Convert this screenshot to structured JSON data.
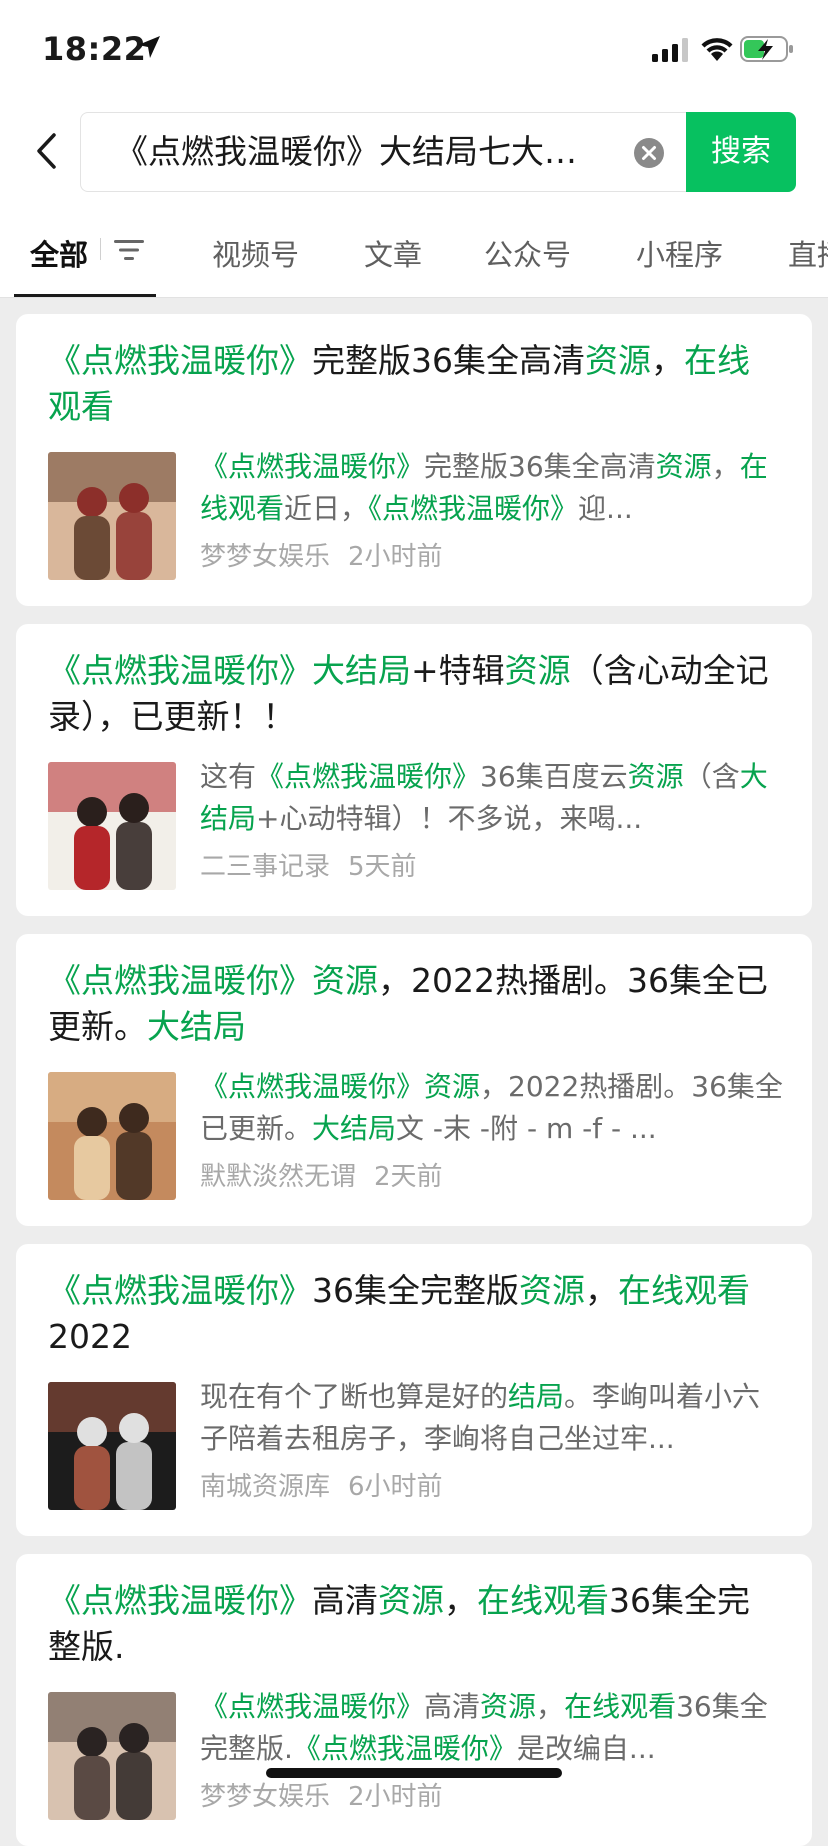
{
  "status_bar": {
    "time": "18:22",
    "icons": [
      "location-arrow-icon",
      "cellular-signal-icon",
      "wifi-icon",
      "battery-charging-icon"
    ]
  },
  "search": {
    "query": "《点燃我温暖你》大结局七大…",
    "button_label": "搜索"
  },
  "tabs": [
    {
      "label": "全部",
      "active": true
    },
    {
      "label": "视频号"
    },
    {
      "label": "文章"
    },
    {
      "label": "公众号"
    },
    {
      "label": "小程序"
    },
    {
      "label": "直播"
    }
  ],
  "colors": {
    "accent": "#07c160",
    "highlight_text": "#07a34e",
    "background": "#ededed"
  },
  "results": [
    {
      "title": [
        {
          "t": "《点燃我温暖你》",
          "hl": true
        },
        {
          "t": "完整版36集全高清"
        },
        {
          "t": "资源",
          "hl": true
        },
        {
          "t": "，"
        },
        {
          "t": "在线观看",
          "hl": true
        }
      ],
      "snippet": [
        {
          "t": "《点燃我温暖你》",
          "hl": true
        },
        {
          "t": "完整版36集全高清"
        },
        {
          "t": "资源",
          "hl": true
        },
        {
          "t": "，"
        },
        {
          "t": "在线观看",
          "hl": true
        },
        {
          "t": "近日，"
        },
        {
          "t": "《点燃我温暖你》",
          "hl": true
        },
        {
          "t": "迎..."
        }
      ],
      "source": "梦梦女娱乐",
      "time": "2小时前",
      "thumb_colors": [
        "#6b4a36",
        "#d9b79b",
        "#8c2f2a"
      ]
    },
    {
      "title": [
        {
          "t": "《点燃我温暖你》",
          "hl": true
        },
        {
          "t": "大结局",
          "hl": true
        },
        {
          "t": "+特辑"
        },
        {
          "t": "资源",
          "hl": true
        },
        {
          "t": "（含心动全记录），已更新！！"
        }
      ],
      "snippet": [
        {
          "t": "这有"
        },
        {
          "t": "《点燃我温暖你》",
          "hl": true
        },
        {
          "t": "36集百度云"
        },
        {
          "t": "资源",
          "hl": true
        },
        {
          "t": "（含"
        },
        {
          "t": "大结局",
          "hl": true
        },
        {
          "t": "+心动特辑）！不多说，来喝..."
        }
      ],
      "source": "二三事记录",
      "time": "5天前",
      "thumb_colors": [
        "#b5262a",
        "#f2efe9",
        "#2a1f1c"
      ]
    },
    {
      "title": [
        {
          "t": "《点燃我温暖你》",
          "hl": true
        },
        {
          "t": "资源",
          "hl": true
        },
        {
          "t": "，2022热播剧。36集全已更新。"
        },
        {
          "t": "大结局",
          "hl": true
        }
      ],
      "snippet": [
        {
          "t": "《点燃我温暖你》",
          "hl": true
        },
        {
          "t": "资源",
          "hl": true
        },
        {
          "t": "，2022热播剧。36集全已更新。"
        },
        {
          "t": "大结局",
          "hl": true
        },
        {
          "t": "文 -末 -附 - m -f - ..."
        }
      ],
      "source": "默默淡然无谓",
      "time": "2天前",
      "thumb_colors": [
        "#e7c9a0",
        "#c48a5e",
        "#3e2a1e"
      ]
    },
    {
      "title": [
        {
          "t": "《点燃我温暖你》",
          "hl": true
        },
        {
          "t": "36集全完整版"
        },
        {
          "t": "资源",
          "hl": true
        },
        {
          "t": "，"
        },
        {
          "t": "在线观看",
          "hl": true
        },
        {
          "t": "2022"
        }
      ],
      "snippet": [
        {
          "t": "现在有个了断也算是好的"
        },
        {
          "t": "结局",
          "hl": true
        },
        {
          "t": "。李峋叫着小六子陪着去租房子，李峋将自己坐过牢..."
        }
      ],
      "source": "南城资源库",
      "time": "6小时前",
      "thumb_colors": [
        "#a0533f",
        "#1c1c1c",
        "#e0e0e0"
      ]
    },
    {
      "title": [
        {
          "t": "《点燃我温暖你》",
          "hl": true
        },
        {
          "t": "高清"
        },
        {
          "t": "资源",
          "hl": true
        },
        {
          "t": "，"
        },
        {
          "t": "在线观看",
          "hl": true
        },
        {
          "t": "36集全完整版."
        }
      ],
      "snippet": [
        {
          "t": "《点燃我温暖你》",
          "hl": true
        },
        {
          "t": "高清"
        },
        {
          "t": "资源",
          "hl": true
        },
        {
          "t": "，"
        },
        {
          "t": "在线观看",
          "hl": true
        },
        {
          "t": "36集全完整版."
        },
        {
          "t": "《点燃我温暖你》",
          "hl": true
        },
        {
          "t": "是改编自..."
        }
      ],
      "source": "梦梦女娱乐",
      "time": "2小时前",
      "thumb_colors": [
        "#5a4a44",
        "#d8c2b0",
        "#2a2322"
      ]
    }
  ]
}
